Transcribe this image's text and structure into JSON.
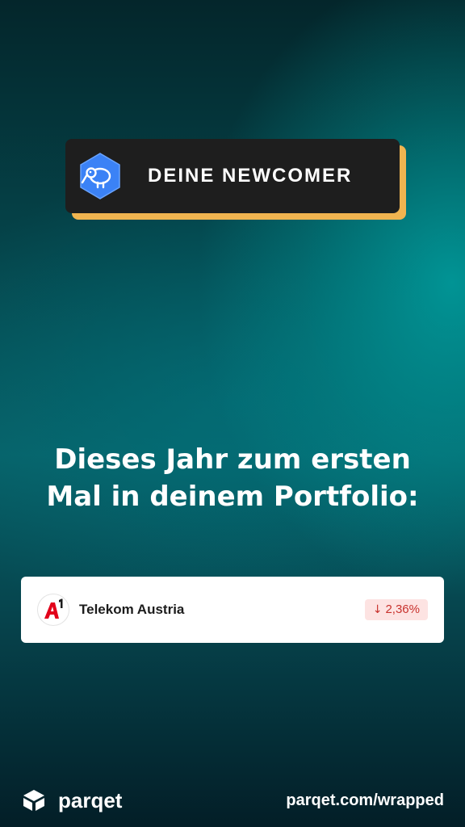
{
  "header": {
    "title": "DEINE NEWCOMER",
    "icon": "kiwi-bird-icon",
    "badge_color": "#1e1e1e",
    "badge_shadow_color": "#f0b450",
    "icon_bg_color": "#3b82f6"
  },
  "headline": {
    "line1": "Dieses Jahr zum ersten",
    "line2": "Mal in deinem Portfolio:"
  },
  "newcomers": [
    {
      "name": "Telekom Austria",
      "logo": "a1-logo",
      "change_arrow": "↓",
      "change": "2,36%",
      "change_direction": "down",
      "change_color": "#c8322d",
      "change_bg_color": "#fde3e2"
    }
  ],
  "footer": {
    "brand": "parqet",
    "brand_icon": "parqet-logo-icon",
    "url": "parqet.com/wrapped"
  }
}
